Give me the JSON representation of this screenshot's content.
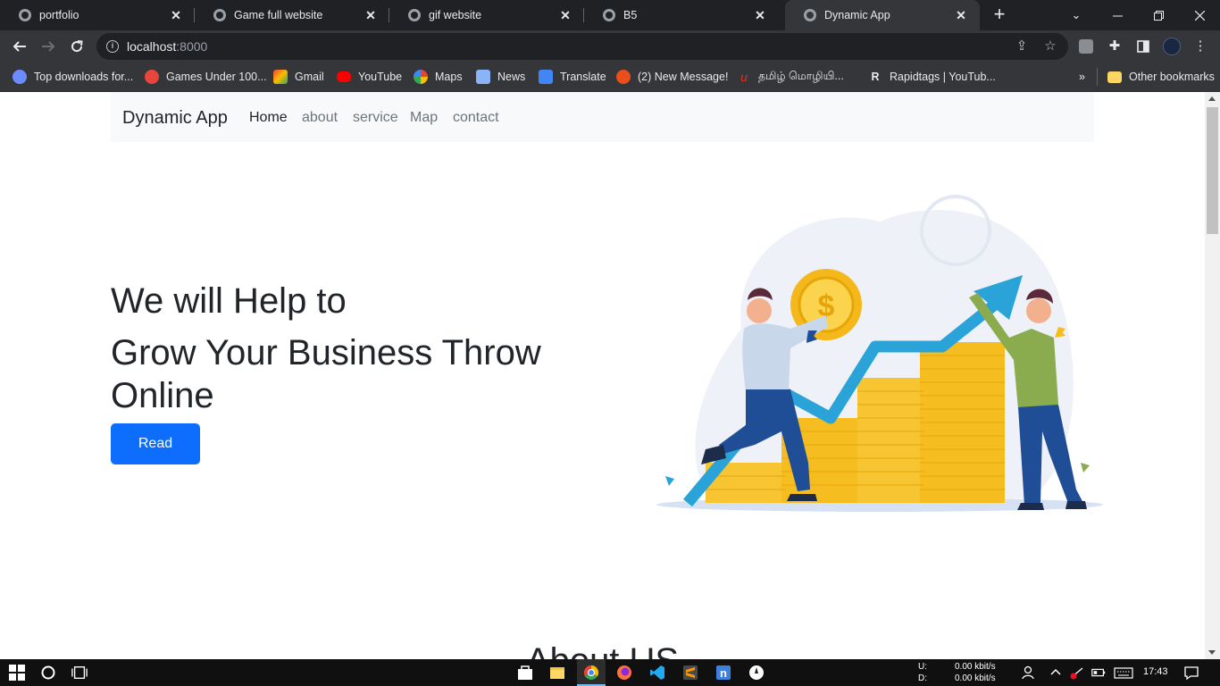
{
  "browser": {
    "tabs": [
      {
        "title": "portfolio",
        "active": false
      },
      {
        "title": "Game full website",
        "active": false
      },
      {
        "title": "gif website",
        "active": false
      },
      {
        "title": "B5",
        "active": false
      },
      {
        "title": "Dynamic App",
        "active": true
      }
    ],
    "address": {
      "host": "localhost",
      "port": ":8000"
    },
    "bookmarks": [
      {
        "label": "Top downloads for...",
        "color": "#6b8cff"
      },
      {
        "label": "Games Under 100...",
        "color": "#e8453c"
      },
      {
        "label": "Gmail",
        "color": "#ea4335"
      },
      {
        "label": "YouTube",
        "color": "#ff0000"
      },
      {
        "label": "Maps",
        "color": "#4285f4"
      },
      {
        "label": "News",
        "color": "#8ab4f8"
      },
      {
        "label": "Translate",
        "color": "#4285f4"
      },
      {
        "label": "(2) New Message!",
        "color": "#e94e1b"
      },
      {
        "label": "தமிழ் மொழியி...",
        "color": "#d93025"
      },
      {
        "label": "Rapidtags | YouTub...",
        "color": "#111111"
      }
    ],
    "other_bookmarks": "Other bookmarks"
  },
  "site": {
    "brand": "Dynamic App",
    "nav": [
      "Home",
      "about",
      "service",
      "Map",
      "contact"
    ],
    "hero": {
      "line1": "We will Help to",
      "line2": "Grow Your Business Throw Online",
      "button": "Read"
    },
    "about_heading": "About US",
    "accent": "#0d6efd"
  },
  "taskbar": {
    "net_up_label": "U:",
    "net_up": "0.00 kbit/s",
    "net_down_label": "D:",
    "net_down": "0.00 kbit/s",
    "time": "17:43"
  }
}
